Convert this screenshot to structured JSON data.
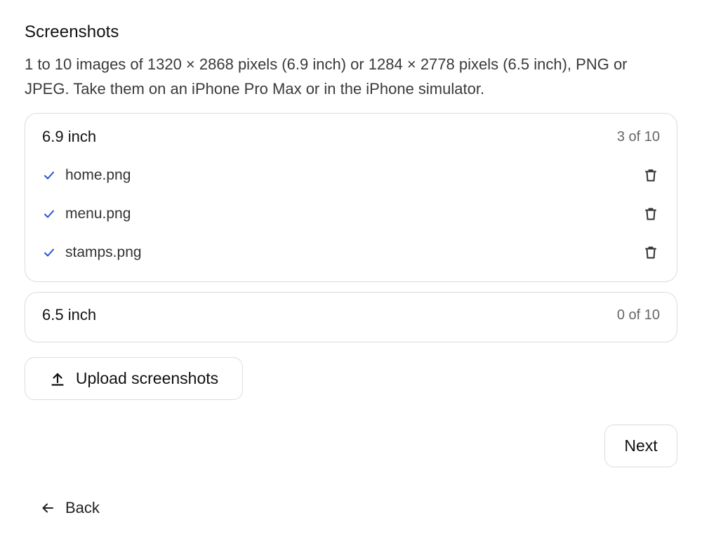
{
  "section": {
    "title": "Screenshots",
    "description": "1 to 10 images of 1320 × 2868 pixels (6.9 inch) or 1284 × 2778 pixels (6.5 inch), PNG or JPEG. Take them on an iPhone Pro Max or in the iPhone simulator."
  },
  "groups": [
    {
      "name": "6.9 inch",
      "count": "3 of 10",
      "files": [
        {
          "name": "home.png",
          "status_icon": "check-icon",
          "action_icon": "trash-icon"
        },
        {
          "name": "menu.png",
          "status_icon": "check-icon",
          "action_icon": "trash-icon"
        },
        {
          "name": "stamps.png",
          "status_icon": "check-icon",
          "action_icon": "trash-icon"
        }
      ]
    },
    {
      "name": "6.5 inch",
      "count": "0 of 10",
      "files": []
    }
  ],
  "actions": {
    "upload_label": "Upload screenshots",
    "upload_icon": "upload-icon",
    "next_label": "Next",
    "back_label": "Back",
    "back_icon": "arrow-left-icon"
  },
  "colors": {
    "check": "#2f4fd6",
    "border": "#dcdcdc",
    "text": "#111111",
    "muted": "#666666"
  }
}
